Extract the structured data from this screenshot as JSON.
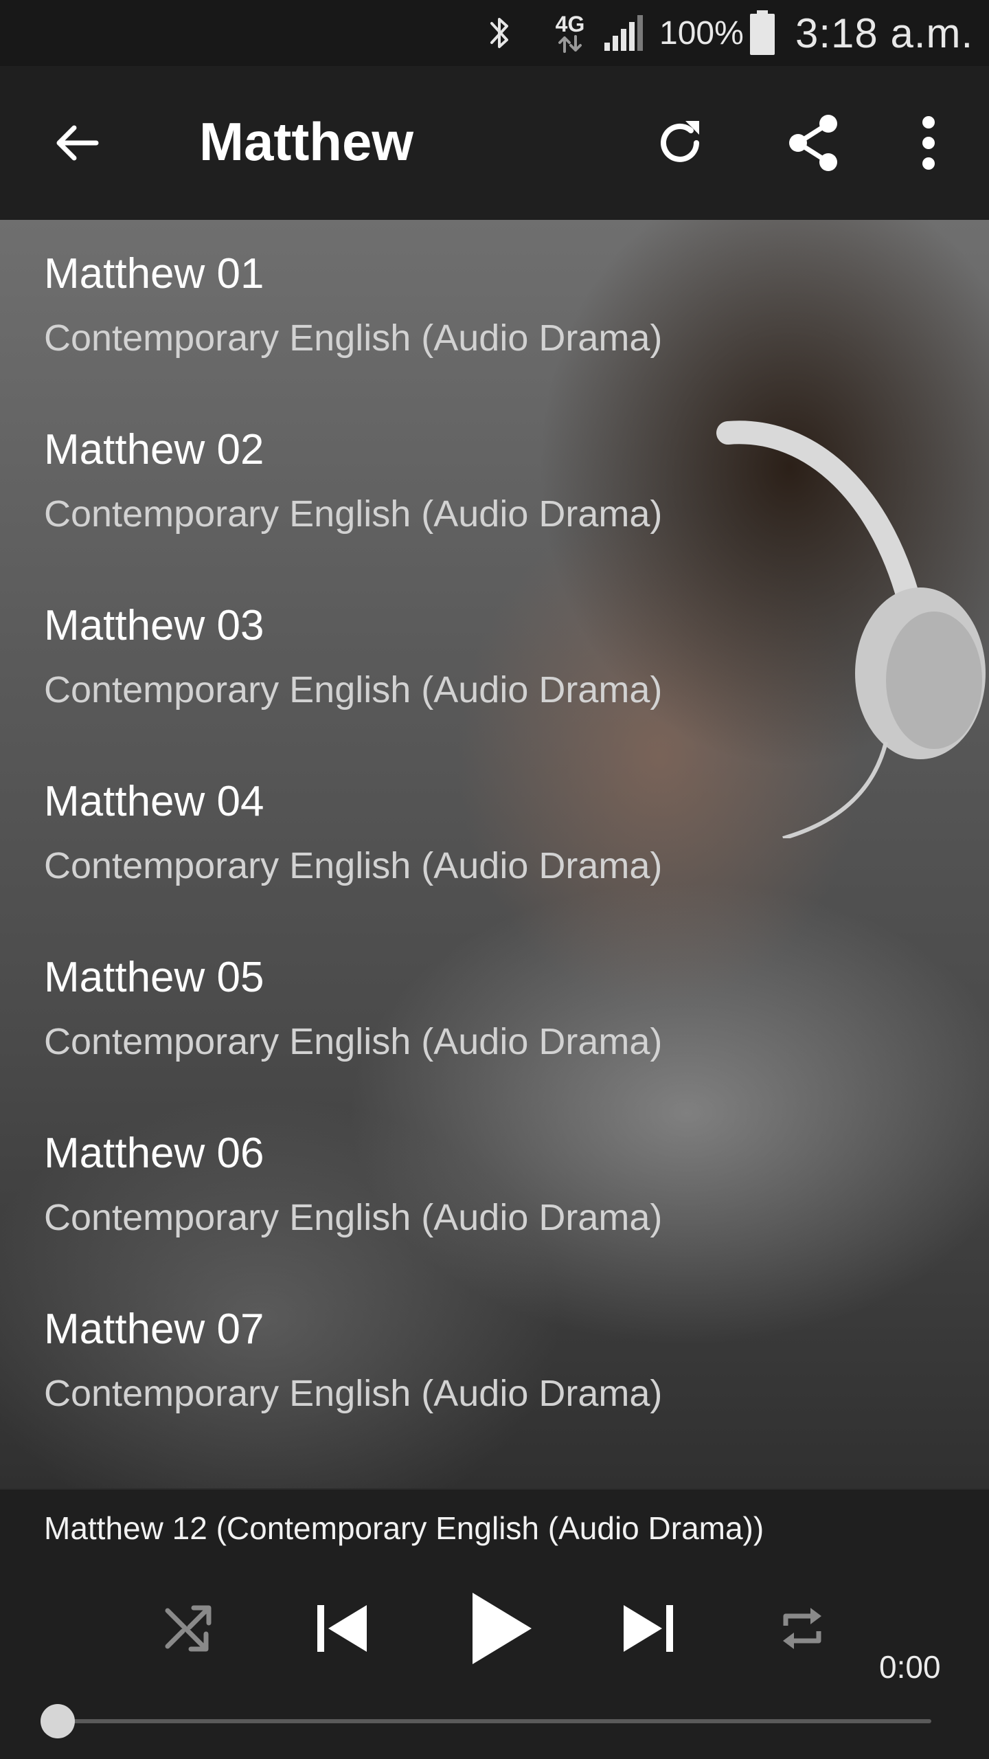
{
  "status_bar": {
    "network": "4G",
    "battery_percent": "100%",
    "time": "3:18 a.m.",
    "icons": [
      "bluetooth-icon",
      "network-4g-icon",
      "signal-icon",
      "battery-icon"
    ]
  },
  "app_bar": {
    "title": "Matthew",
    "actions": [
      "back-arrow-icon",
      "refresh-icon",
      "share-icon",
      "more-vert-icon"
    ]
  },
  "tracks": [
    {
      "title": "Matthew 01",
      "subtitle": "Contemporary English (Audio Drama)"
    },
    {
      "title": "Matthew 02",
      "subtitle": "Contemporary English (Audio Drama)"
    },
    {
      "title": "Matthew 03",
      "subtitle": "Contemporary English (Audio Drama)"
    },
    {
      "title": "Matthew 04",
      "subtitle": "Contemporary English (Audio Drama)"
    },
    {
      "title": "Matthew 05",
      "subtitle": "Contemporary English (Audio Drama)"
    },
    {
      "title": "Matthew 06",
      "subtitle": "Contemporary English (Audio Drama)"
    },
    {
      "title": "Matthew 07",
      "subtitle": "Contemporary English (Audio Drama)"
    }
  ],
  "player": {
    "now_playing": "Matthew 12 (Contemporary English (Audio Drama))",
    "elapsed": "0:00",
    "progress": 0,
    "controls": [
      "shuffle-icon",
      "skip-previous-icon",
      "play-icon",
      "skip-next-icon",
      "repeat-icon"
    ]
  },
  "colors": {
    "status_bar_bg": "#181818",
    "app_bar_bg": "#1f1f1f",
    "player_bg": "#1f1f1f",
    "text_primary": "#ffffff",
    "text_secondary": "#d2d2d2",
    "disabled_control": "#8a8a8a"
  }
}
